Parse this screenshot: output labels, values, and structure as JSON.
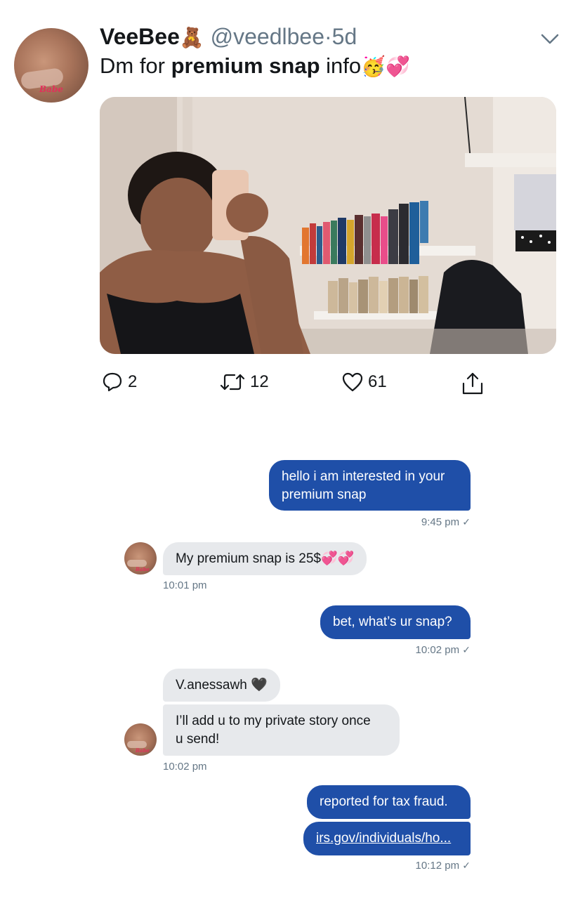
{
  "tweet": {
    "display_name": "VeeBee",
    "display_name_emoji": "🧸",
    "handle": "@veedlbee",
    "separator": "·",
    "age": "5d",
    "text_before": "Dm for ",
    "text_bold": "premium snap",
    "text_after": " info",
    "text_emojis": "🥳💞",
    "avatar_text": "Babe",
    "actions": {
      "replies": "2",
      "retweets": "12",
      "likes": "61"
    }
  },
  "dm": {
    "messages": [
      {
        "from": "me",
        "text_lines": [
          "hello i am interested in your",
          "premium snap"
        ],
        "time": "9:45 pm",
        "read": "✓"
      },
      {
        "from": "them",
        "text": "My premium snap is 25$💞💞",
        "time": "10:01 pm"
      },
      {
        "from": "me",
        "text": "bet, what’s ur snap?",
        "time": "10:02 pm",
        "read": "✓"
      },
      {
        "from": "them",
        "text": "V.anessawh 🖤"
      },
      {
        "from": "them",
        "text_lines": [
          "I’ll add u to my private story once",
          "u send!"
        ],
        "time": "10:02 pm"
      },
      {
        "from": "me",
        "text": "reported for tax fraud."
      },
      {
        "from": "me",
        "text": "irs.gov/individuals/ho...",
        "time": "10:12 pm",
        "read": "✓"
      }
    ],
    "avatar_text": "Babe"
  },
  "colors": {
    "sent_bubble": "#1f4fa8",
    "received_bubble": "#e7e9ec",
    "meta_text": "#657786",
    "primary_text": "#14171a"
  }
}
